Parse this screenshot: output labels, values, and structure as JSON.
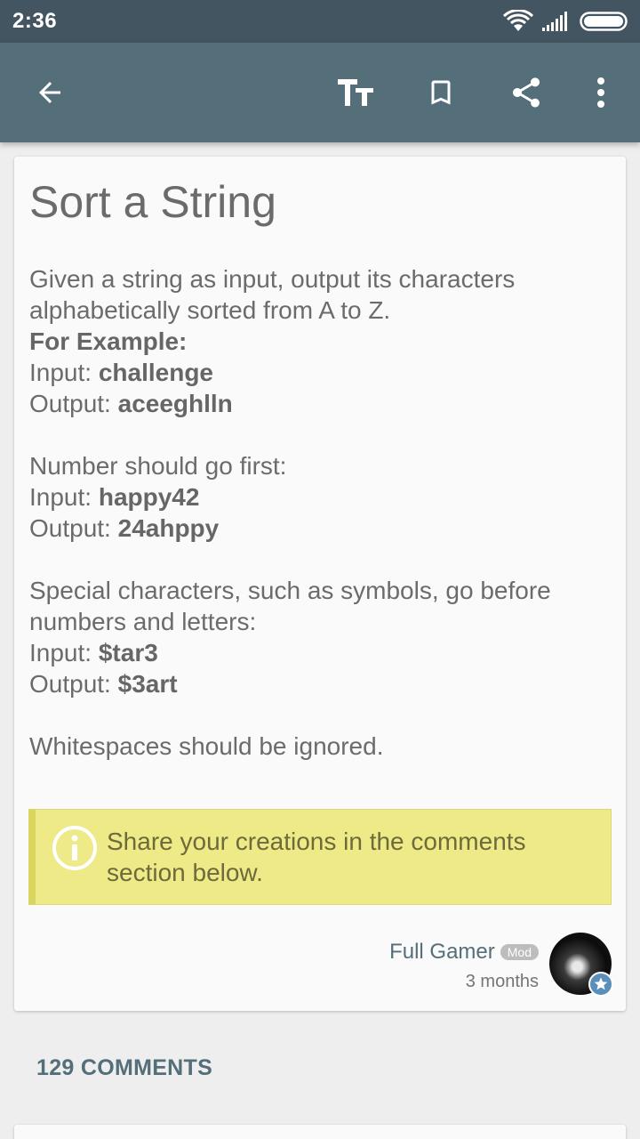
{
  "status_bar": {
    "time": "2:36"
  },
  "toolbar": {
    "icons": [
      "arrow-back-icon",
      "text-size-icon",
      "bookmark-icon",
      "share-icon",
      "more-vert-icon"
    ]
  },
  "post": {
    "title": "Sort a String",
    "intro": "Given a string as input, output its characters alphabetically sorted from A to Z.",
    "example_heading": "For Example:",
    "input_label": "Input: ",
    "output_label": "Output: ",
    "example1": {
      "input": "challenge",
      "output": "aceeghlln"
    },
    "rule2": "Number should go first:",
    "example2": {
      "input": "happy42",
      "output": "24ahppy"
    },
    "rule3": "Special characters, such as symbols, go before numbers and letters:",
    "example3": {
      "input": "$tar3",
      "output": "$3art"
    },
    "rule4": "Whitespaces should be ignored.",
    "info": "Share your creations in the comments section below."
  },
  "author": {
    "name": "Full Gamer",
    "badge": "Mod",
    "time": "3 months"
  },
  "comments": {
    "label": "129 COMMENTS"
  },
  "colors": {
    "status_bar": "#435560",
    "app_bar": "#546e7a",
    "info_bg": "#eeea87",
    "info_border": "#d9d55e"
  }
}
